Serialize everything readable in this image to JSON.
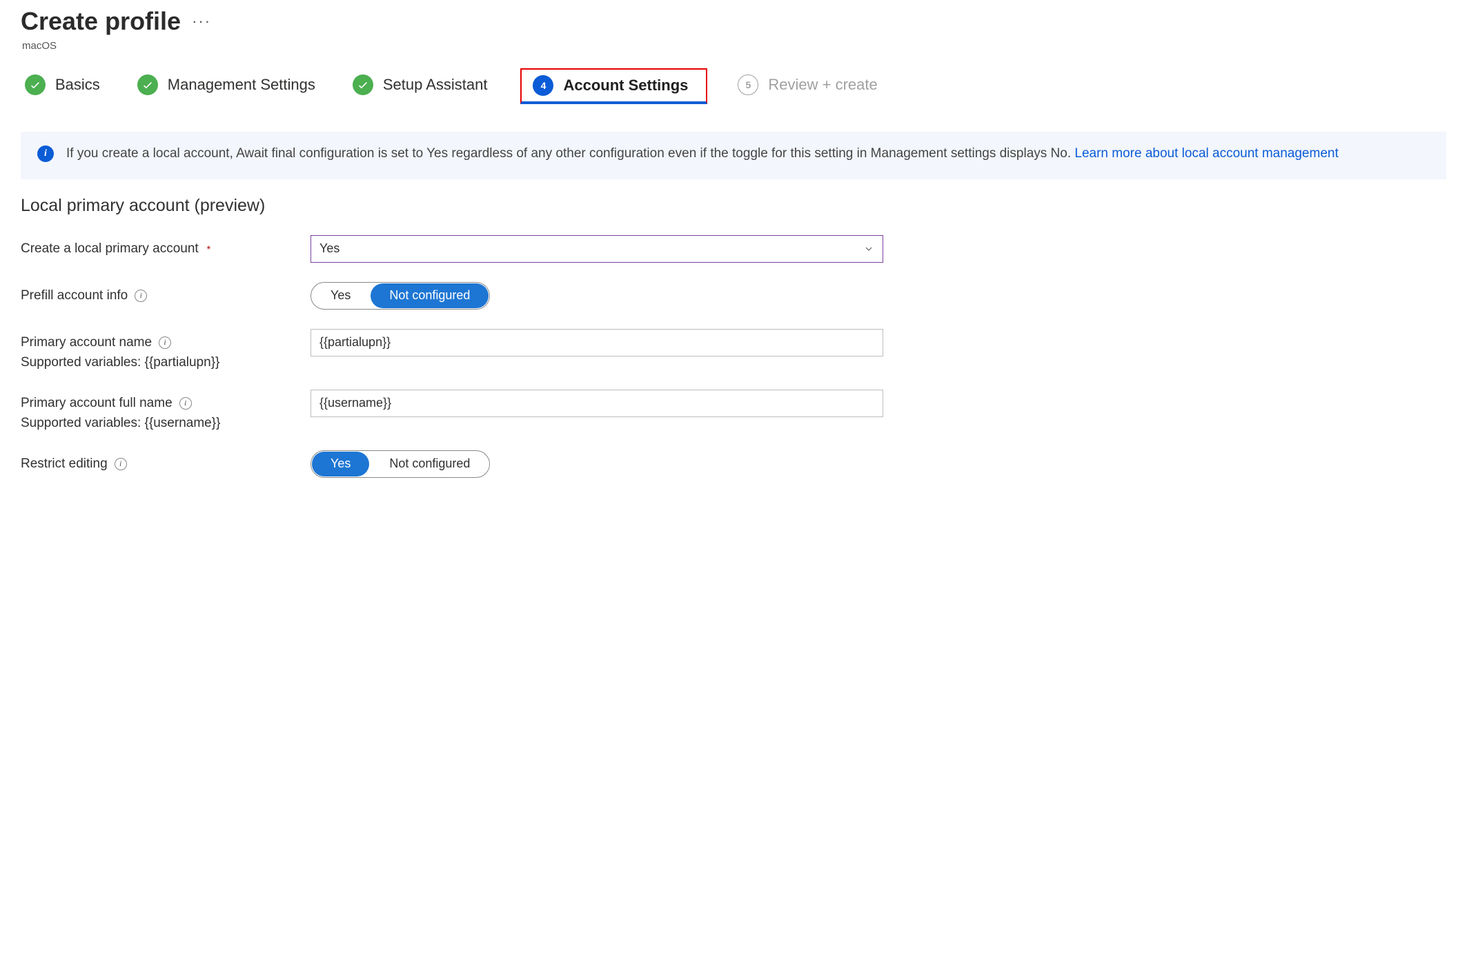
{
  "header": {
    "title": "Create profile",
    "ellipsis": "···",
    "subtitle": "macOS"
  },
  "steps": [
    {
      "label": "Basics",
      "state": "done"
    },
    {
      "label": "Management Settings",
      "state": "done"
    },
    {
      "label": "Setup Assistant",
      "state": "done"
    },
    {
      "label": "Account Settings",
      "state": "active",
      "number": "4"
    },
    {
      "label": "Review + create",
      "state": "inactive",
      "number": "5"
    }
  ],
  "info_banner": {
    "text_before_link": "If you create a local account, Await final configuration is set to Yes regardless of any other configuration even if the toggle for this setting in Management settings displays No. ",
    "link_text": "Learn more about local account management"
  },
  "section": {
    "heading": "Local primary account (preview)"
  },
  "form": {
    "create_account": {
      "label": "Create a local primary account",
      "required_marker": "*",
      "value": "Yes"
    },
    "prefill": {
      "label": "Prefill account info",
      "options": {
        "yes": "Yes",
        "not_configured": "Not configured"
      },
      "selected": "not_configured"
    },
    "account_name": {
      "label": "Primary account name",
      "value": "{{partialupn}}",
      "helper": "Supported variables: {{partialupn}}"
    },
    "full_name": {
      "label": "Primary account full name",
      "value": "{{username}}",
      "helper": "Supported variables: {{username}}"
    },
    "restrict": {
      "label": "Restrict editing",
      "options": {
        "yes": "Yes",
        "not_configured": "Not configured"
      },
      "selected": "yes"
    }
  }
}
